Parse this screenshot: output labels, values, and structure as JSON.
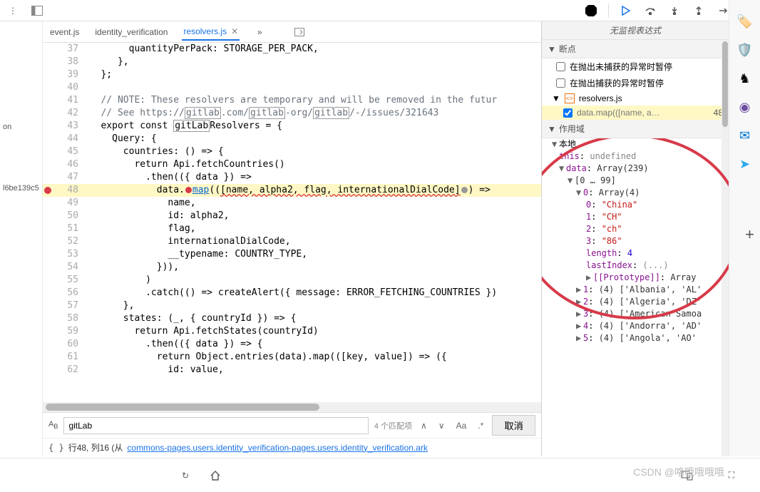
{
  "tabs": [
    {
      "label": "event.js",
      "active": false
    },
    {
      "label": "identity_verification",
      "active": false
    },
    {
      "label": "resolvers.js",
      "active": true
    }
  ],
  "code": {
    "37": "        quantityPerPack: STORAGE_PER_PACK,",
    "38": "      },",
    "39": "   };",
    "40": "",
    "41_a": "   // NOTE: These resolvers are temporary and will be removed in the futur",
    "42_a": "   // See https://",
    "42_b": "gitlab",
    "42_c": ".com/",
    "42_d": "gitlab",
    "42_e": "-org/",
    "42_f": "gitlab",
    "42_g": "/-/issues/321643",
    "43_a": "   export const ",
    "43_b": "gitLab",
    "43_c": "Resolvers = {",
    "44": "     Query: {",
    "45": "       countries: () => {",
    "46": "         return Api.fetchCountries()",
    "47": "           .then(({ data }) =>",
    "48_a": "             data.",
    "48_b": "map",
    "48_c": "((",
    "48_d": "[name, alpha2, flag, internationalDialCode]",
    "48_e": ") =>",
    "49": "               name,",
    "50": "               id: alpha2,",
    "51": "               flag,",
    "52": "               internationalDialCode,",
    "53": "               __typename: COUNTRY_TYPE,",
    "54": "             })),",
    "55": "           )",
    "56": "           .catch(() => createAlert({ message: ERROR_FETCHING_COUNTRIES })",
    "57": "       },",
    "58": "       states: (_, { countryId }) => {",
    "59": "         return Api.fetchStates(countryId)",
    "60": "           .then(({ data }) => {",
    "61": "             return Object.entries(data).map(([key, value]) => ({",
    "62": "               id: value,"
  },
  "search": {
    "value": "gitLab",
    "matches": "4 个匹配项",
    "cancel": "取消",
    "case_opt": "Aa",
    "regex_opt": ".*"
  },
  "status": {
    "brace": "{ }",
    "prefix": "行48, 列16 (从",
    "link": "commons-pages.users.identity_verification-pages.users.identity_verification.ark"
  },
  "debug": {
    "watch_header": "无监视表达式",
    "breakpoints_header": "断点",
    "pause_uncaught": "在抛出未捕获的异常时暂停",
    "pause_caught": "在抛出捕获的异常时暂停",
    "bp_file": "resolvers.js",
    "bp_line_text": "data.map(([name, a…",
    "bp_line_num": "48",
    "scope_header": "作用域",
    "local_header": "本地",
    "this_label": "this",
    "this_val": "undefined",
    "data_label": "data",
    "data_val": "Array(239)",
    "range_label": "[0 … 99]",
    "idx0_label": "0",
    "idx0_val": "Array(4)",
    "a0_k": "0",
    "a0_v": "\"China\"",
    "a1_k": "1",
    "a1_v": "\"CH\"",
    "a2_k": "2",
    "a2_v": "\"ch\"",
    "a3_k": "3",
    "a3_v": "\"86\"",
    "len_k": "length",
    "len_v": "4",
    "lastidx_k": "lastIndex",
    "lastidx_v": "(...)",
    "proto_k": "[[Prototype]]",
    "proto_v": "Array",
    "r1_k": "1",
    "r1_v": "(4) ['Albania', 'AL'",
    "r2_k": "2",
    "r2_v": "(4) ['Algeria', 'DZ'",
    "r3_k": "3",
    "r3_v": "(4) ['American Samoa",
    "r4_k": "4",
    "r4_v": "(4) ['Andorra', 'AD'",
    "r5_k": "5",
    "r5_v": "(4) ['Angola', 'AO'"
  },
  "left": {
    "on": "on",
    "hash": "l6be139c5"
  },
  "watermark": "CSDN @咯哦哦哦哦"
}
